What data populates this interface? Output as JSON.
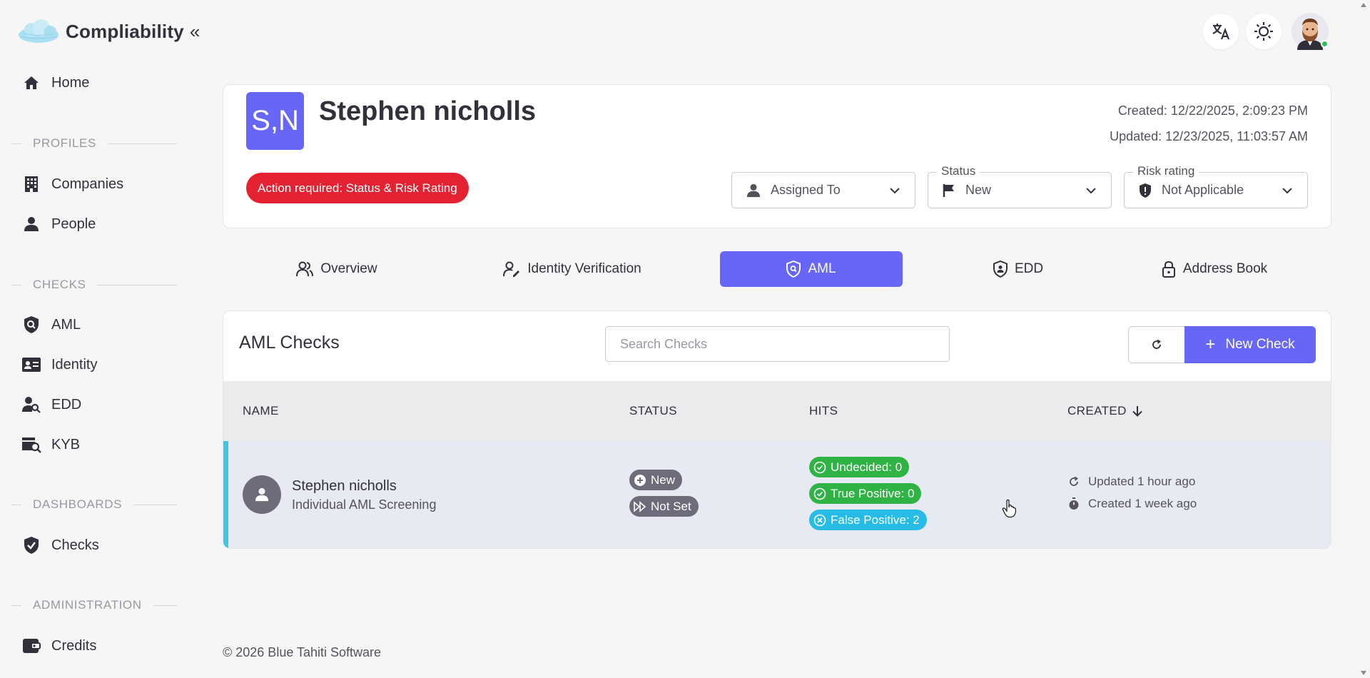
{
  "app": {
    "name": "Compliability",
    "footer": "© 2026 Blue Tahiti Software"
  },
  "sidebar": {
    "home": "Home",
    "sections": {
      "profiles": "PROFILES",
      "checks": "CHECKS",
      "dashboards": "DASHBOARDS",
      "administration": "ADMINISTRATION"
    },
    "items": {
      "companies": "Companies",
      "people": "People",
      "aml": "AML",
      "identity": "Identity",
      "edd": "EDD",
      "kyb": "KYB",
      "checks": "Checks",
      "credits": "Credits"
    }
  },
  "profile": {
    "initials": "S,N",
    "name": "Stephen nicholls",
    "created": "Created: 12/22/2025, 2:09:23 PM",
    "updated": "Updated: 12/23/2025, 11:03:57 AM",
    "action_required": "Action required: Status & Risk Rating",
    "assigned_to": {
      "placeholder": "Assigned To"
    },
    "status": {
      "label": "Status",
      "value": "New"
    },
    "risk_rating": {
      "label": "Risk rating",
      "value": "Not Applicable"
    }
  },
  "tabs": {
    "overview": "Overview",
    "identity_verification": "Identity Verification",
    "aml": "AML",
    "edd": "EDD",
    "address_book": "Address Book",
    "active": "AML"
  },
  "aml_checks": {
    "title": "AML Checks",
    "search_placeholder": "Search Checks",
    "new_check_label": "New Check",
    "columns": {
      "name": "NAME",
      "status": "STATUS",
      "hits": "HITS",
      "created": "CREATED"
    },
    "rows": [
      {
        "name": "Stephen nicholls",
        "type": "Individual AML Screening",
        "status": "New",
        "sub_status": "Not Set",
        "hits": {
          "undecided": "Undecided: 0",
          "true_positive": "True Positive: 0",
          "false_positive": "False Positive: 2"
        },
        "updated": "Updated 1 hour ago",
        "created": "Created 1 week ago"
      }
    ]
  },
  "colors": {
    "accent": "#6766f7",
    "danger": "#e52232",
    "success": "#2fb344",
    "info": "#26bce5",
    "row_indicator": "#3fc6e3"
  }
}
